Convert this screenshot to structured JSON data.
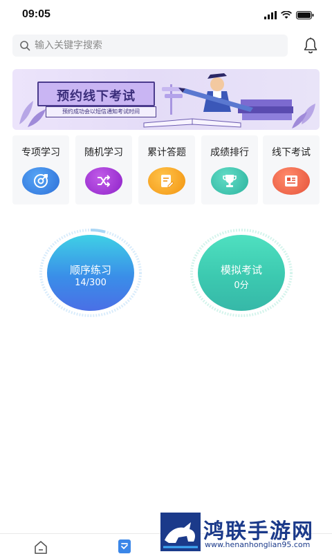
{
  "status_bar": {
    "time": "09:05"
  },
  "search": {
    "placeholder": "输入关键字搜索",
    "value": ""
  },
  "banner": {
    "title": "预约线下考试",
    "subtitle": "预约成功会以短信通知考试时间"
  },
  "features": [
    {
      "label": "专项学习",
      "icon": "target-icon",
      "color": "#3a86e8"
    },
    {
      "label": "随机学习",
      "icon": "shuffle-icon",
      "color": "#a434d8"
    },
    {
      "label": "累计答题",
      "icon": "note-edit-icon",
      "color": "#f5a623"
    },
    {
      "label": "成绩排行",
      "icon": "trophy-icon",
      "color": "#3cc6b4"
    },
    {
      "label": "线下考试",
      "icon": "newspaper-icon",
      "color": "#f06b4e"
    }
  ],
  "practice": {
    "sequential": {
      "title": "顺序练习",
      "value": "14/300",
      "progress": 0.047
    },
    "mock_exam": {
      "title": "模拟考试",
      "value": "0分"
    }
  },
  "tabbar": {
    "items": [
      "home-icon",
      "practice-icon"
    ]
  },
  "watermark": {
    "text": "鸿联手游网",
    "url": "www.henanhonglian95.com"
  },
  "colors": {
    "accent_blue": "#3a86e8",
    "accent_teal": "#3fd4b4",
    "banner_purple": "#c9b5f3"
  }
}
